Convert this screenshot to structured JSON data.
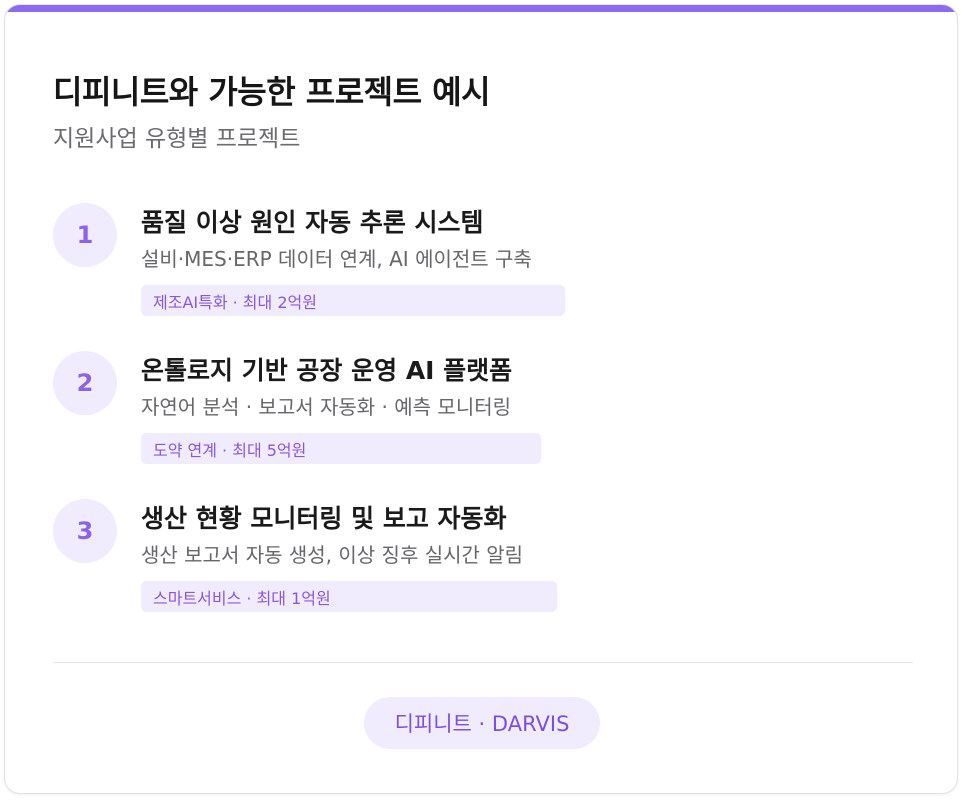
{
  "header": {
    "title": "디피니트와 가능한 프로젝트 예시",
    "subtitle": "지원사업 유형별 프로젝트"
  },
  "projects": [
    {
      "number": "1",
      "title": "품질 이상 원인 자동 추론 시스템",
      "description": "설비·MES·ERP 데이터 연계, AI 에이전트 구축",
      "tag": "제조AI특화 · 최대 2억원"
    },
    {
      "number": "2",
      "title": "온톨로지 기반 공장 운영 AI 플랫폼",
      "description": "자연어 분석 · 보고서 자동화 · 예측 모니터링",
      "tag": "도약 연계 · 최대 5억원"
    },
    {
      "number": "3",
      "title": "생산 현황 모니터링 및 보고 자동화",
      "description": "생산 보고서 자동 생성, 이상 징후 실시간 알림",
      "tag": "스마트서비스 · 최대 1억원"
    }
  ],
  "footer": {
    "label": "디피니트 · DARVIS"
  },
  "colors": {
    "accent": "#8b6cf0",
    "accent_light": "#f1ecfd",
    "accent_text": "#8a57e0"
  }
}
